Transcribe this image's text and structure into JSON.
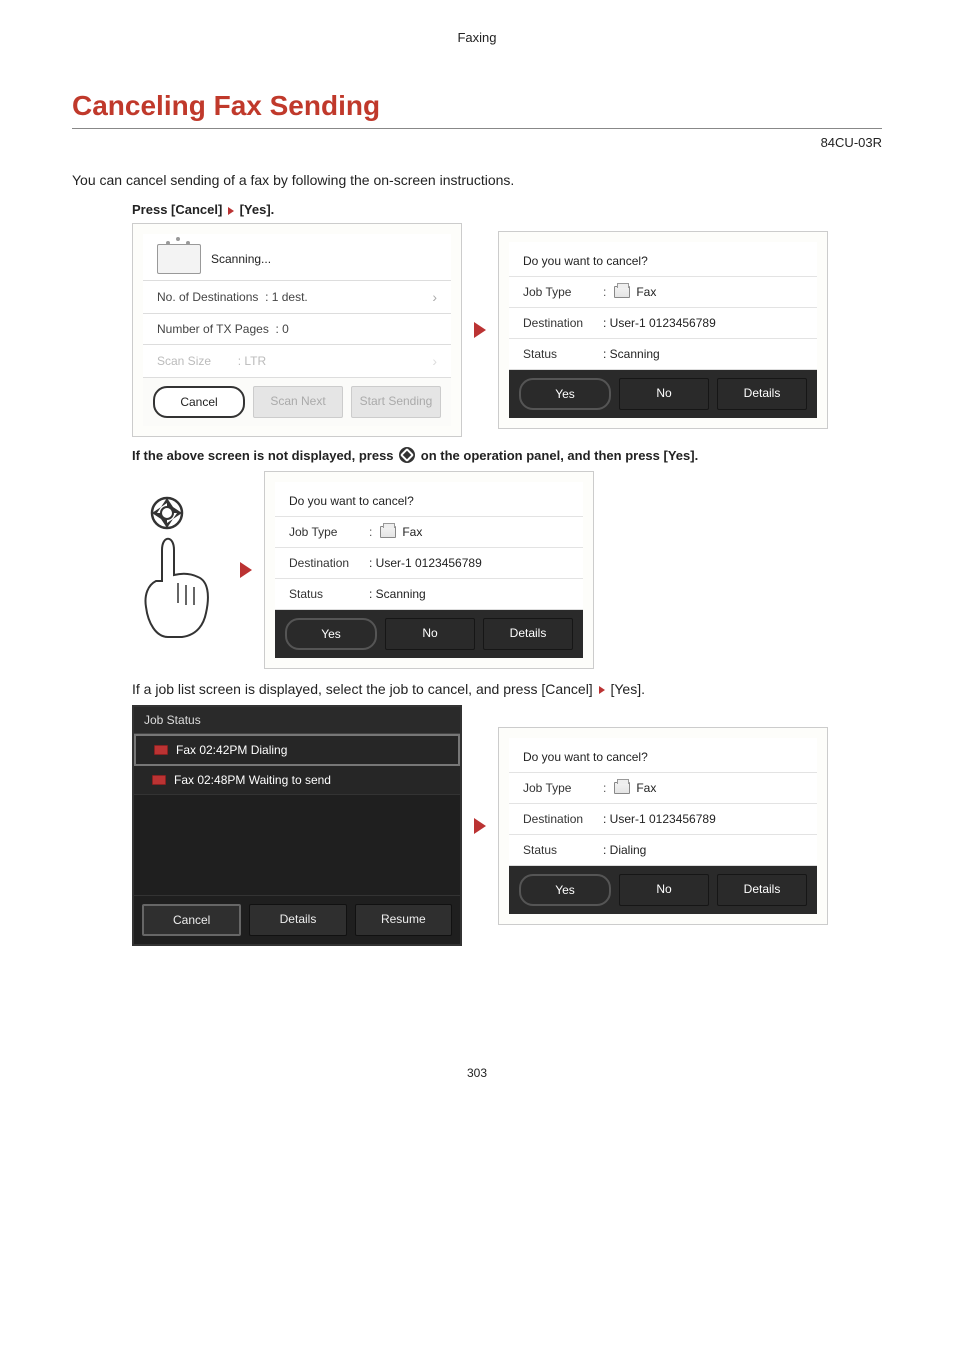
{
  "chapter": "Faxing",
  "h1": "Canceling Fax Sending",
  "doc_code": "84CU-03R",
  "intro": "You can cancel sending of a fax by following the on-screen instructions.",
  "step_parts": {
    "a": "Press [Cancel]",
    "b": "[Yes]."
  },
  "arrow_glyph": "▶",
  "row_chevron": "›",
  "panel_scan": {
    "title": "Scanning...",
    "rows": [
      {
        "label": "No. of Destinations",
        "value": ": 1 dest."
      },
      {
        "label": "Number of TX Pages",
        "value": ": 0"
      },
      {
        "label": "Scan Size",
        "value": ": LTR",
        "disabled": true
      }
    ],
    "buttons": {
      "cancel": "Cancel",
      "scan_next": "Scan Next",
      "start_sending": "Start Sending"
    }
  },
  "confirm_common": {
    "question": "Do you want to cancel?",
    "job_type_label": "Job Type",
    "destination_label": "Destination",
    "status_label": "Status",
    "fax_text": "Fax",
    "destination_value": ": User-1 0123456789",
    "yes": "Yes",
    "no": "No",
    "details": "Details"
  },
  "confirm1_status": ": Scanning",
  "confirm2_status": ": Scanning",
  "confirm3_status": ": Dialing",
  "after_note_parts": {
    "a": "If the above screen is not displayed, press",
    "b": "on the operation panel, and then press [Yes]."
  },
  "plain_note_parts": {
    "a": "If a job list screen is displayed, select the job to cancel, and press [Cancel]",
    "b": "[Yes]."
  },
  "job_panel": {
    "header": "Job Status",
    "items": [
      "Fax 02:42PM Dialing",
      "Fax 02:48PM Waiting to send"
    ],
    "buttons": {
      "cancel": "Cancel",
      "details": "Details",
      "resume": "Resume"
    }
  },
  "page_number": "303"
}
